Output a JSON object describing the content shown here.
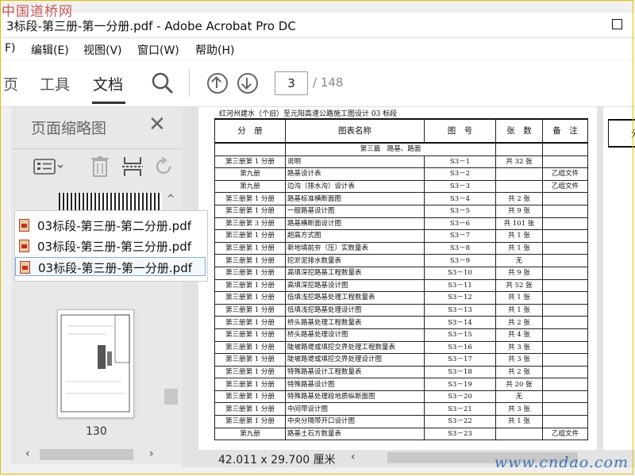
{
  "watermarks": {
    "top": "中国道桥网",
    "bottom": "www.cndao.com"
  },
  "window": {
    "title": "3标段-第三册-第一分册.pdf - Adobe Acrobat Pro DC"
  },
  "menu": {
    "items": [
      "F)",
      "编辑(E)",
      "视图(V)",
      "窗口(W)",
      "帮助(H)"
    ]
  },
  "toolbar": {
    "tabs": [
      "页",
      "工具",
      "文档"
    ],
    "active_tab": "文档",
    "page_current": "3",
    "page_total": "/ 148"
  },
  "left_panel": {
    "title": "页面缩略图",
    "thumbnail_label": "130"
  },
  "open_files": [
    {
      "name": "03标段-第三册-第二分册.pdf",
      "selected": false
    },
    {
      "name": "03标段-第三册-第三分册.pdf",
      "selected": false
    },
    {
      "name": "03标段-第三册-第一分册.pdf",
      "selected": true
    }
  ],
  "document": {
    "heading": "红河州建水（个旧）至元阳高速公路施工图设计 03 标段",
    "columns": [
      "分　册",
      "图表名称",
      "图　号",
      "张　数",
      "备　注"
    ],
    "section_title": "第三篇　路基、路面",
    "rows": [
      [
        "第三册第 1 分册",
        "说明",
        "S3－1",
        "共 32 张",
        ""
      ],
      [
        "第九册",
        "路基设计表",
        "S3－2",
        "",
        "乙组文件"
      ],
      [
        "第九册",
        "边沟（排水沟）设计表",
        "S3－3",
        "",
        "乙组文件"
      ],
      [
        "第三册第 1 分册",
        "路基标准横断面图",
        "S3－4",
        "共 2 张",
        ""
      ],
      [
        "第三册第 1 分册",
        "一般路基设计图",
        "S3－5",
        "共 9 张",
        ""
      ],
      [
        "第三册第 3 分册",
        "路基横断面设计图",
        "S3－6",
        "共 101 张",
        ""
      ],
      [
        "第三册第 1 分册",
        "超高方式图",
        "S3－7",
        "共 1 张",
        ""
      ],
      [
        "第三册第 1 分册",
        "新地填前夯（压）实数量表",
        "S3－8",
        "共 1 张",
        ""
      ],
      [
        "第三册第 1 分册",
        "挖淤泥排水数量表",
        "S3－9",
        "无",
        ""
      ],
      [
        "第三册第 1 分册",
        "高填深挖路基工程数量表",
        "S3－10",
        "共 9 张",
        ""
      ],
      [
        "第三册第 1 分册",
        "高填深挖路基设计图",
        "S3－11",
        "共 52 张",
        ""
      ],
      [
        "第三册第 1 分册",
        "低填浅挖路基处理工程数量表",
        "S3－12",
        "共 1 张",
        ""
      ],
      [
        "第三册第 1 分册",
        "低填浅挖路基处理设计图",
        "S3－13",
        "共 1 张",
        ""
      ],
      [
        "第三册第 1 分册",
        "桥头路基处理工程数量表",
        "S3－14",
        "共 2 张",
        ""
      ],
      [
        "第三册第 1 分册",
        "桥头路基处理设计图",
        "S3－15",
        "共 4 张",
        ""
      ],
      [
        "第三册第 1 分册",
        "陡坡路堤或填挖交界处理工程数量表",
        "S3－16",
        "共 3 张",
        ""
      ],
      [
        "第三册第 1 分册",
        "陡坡路堤或填挖交界处理设计图",
        "S3－17",
        "共 3 张",
        ""
      ],
      [
        "第三册第 1 分册",
        "特殊路基设计工程数量表",
        "S3－18",
        "共 2 张",
        ""
      ],
      [
        "第三册第 1 分册",
        "特殊路基设计图",
        "S3－19",
        "共 20 张",
        ""
      ],
      [
        "第三册第 1 分册",
        "特殊路基处理段地质纵断面图",
        "S3－20",
        "无",
        ""
      ],
      [
        "第三册第 1 分册",
        "中间带设计图",
        "S3－21",
        "共 3 张",
        ""
      ],
      [
        "第三册第 1 分册",
        "中央分隔带开口设计图",
        "S3－22",
        "共 1 张",
        ""
      ],
      [
        "第九册",
        "路基土石方数量表",
        "S3－23",
        "",
        "乙组文件"
      ]
    ],
    "next_page_fragment": "分"
  },
  "status": {
    "dimensions": "42.011 x 29.700 厘米"
  }
}
